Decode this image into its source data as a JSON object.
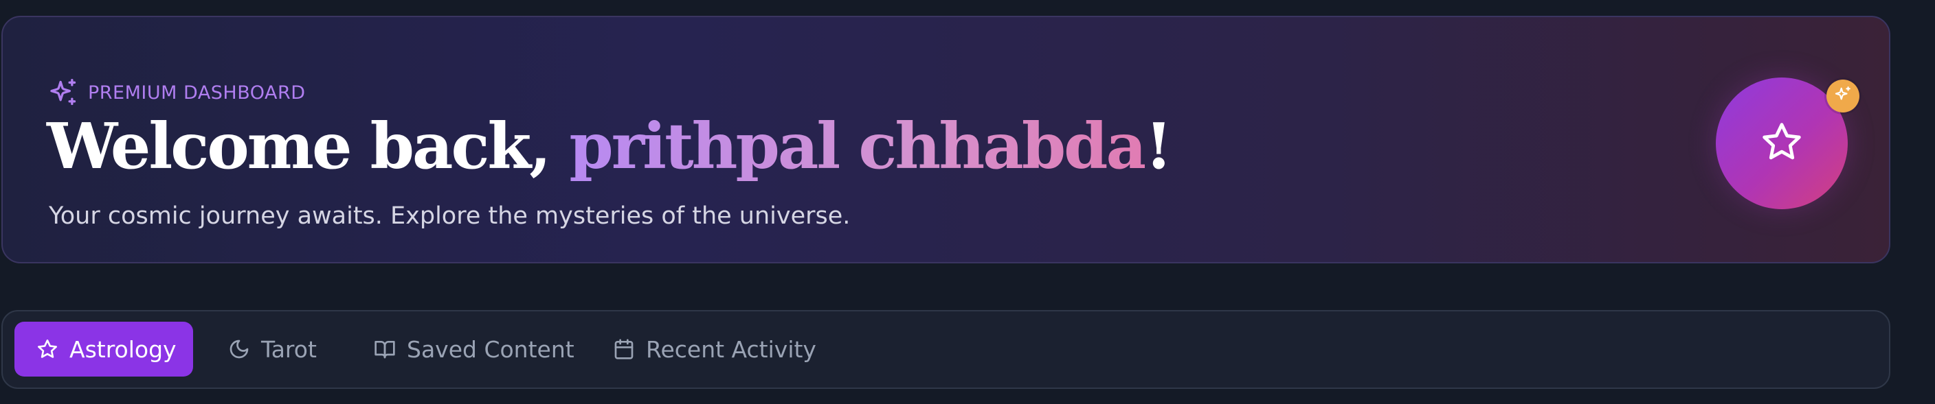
{
  "hero": {
    "eyebrow_label": "PREMIUM DASHBOARD",
    "title_prefix": "Welcome back, ",
    "user_name": "prithpal chhabda",
    "title_suffix": "!",
    "subtitle": "Your cosmic journey awaits. Explore the mysteries of the universe.",
    "eyebrow_icon": "sparkles-icon",
    "avatar_icon": "star-icon",
    "badge_icon": "sparkles-icon"
  },
  "tabs": [
    {
      "label": "Astrology",
      "icon": "star-icon",
      "active": true
    },
    {
      "label": "Tarot",
      "icon": "moon-icon",
      "active": false
    },
    {
      "label": "Saved Content",
      "icon": "book-open-icon",
      "active": false
    },
    {
      "label": "Recent Activity",
      "icon": "calendar-icon",
      "active": false
    }
  ],
  "colors": {
    "background": "#141a26",
    "accent_purple": "#8b34e6",
    "eyebrow": "#b07ef0",
    "badge": "#f0a94a",
    "name_gradient_start": "#b78af2",
    "name_gradient_end": "#e07cb3"
  }
}
